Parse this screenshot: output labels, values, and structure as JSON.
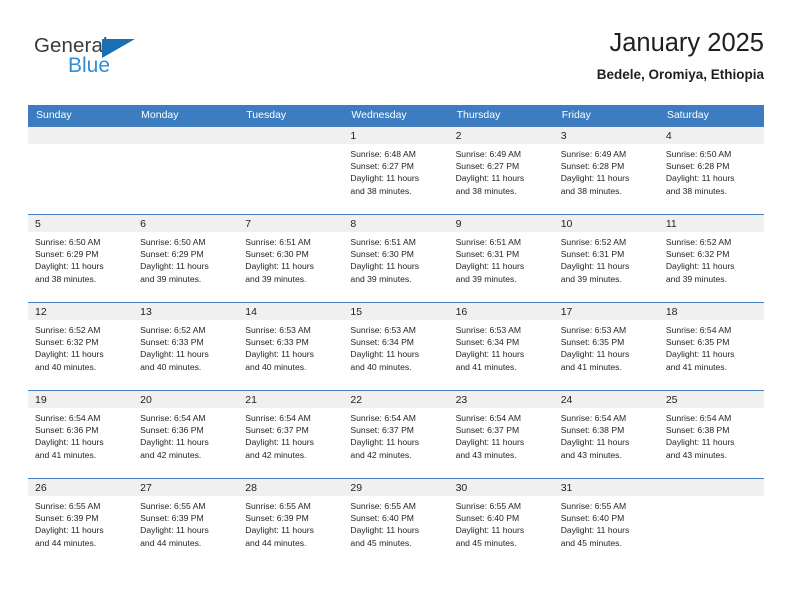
{
  "brand": {
    "name_primary": "General",
    "name_secondary": "Blue"
  },
  "header": {
    "title": "January 2025",
    "subtitle": "Bedele, Oromiya, Ethiopia"
  },
  "theme": {
    "header_blue": "#3c7cc0",
    "grid_line": "#4a7ebb",
    "daynum_band": "#f0f0f0",
    "logo_blue": "#2f8fd6",
    "logo_triangle": "#1a6fb5",
    "text": "#231f20"
  },
  "calendar": {
    "weekday_headers": [
      "Sunday",
      "Monday",
      "Tuesday",
      "Wednesday",
      "Thursday",
      "Friday",
      "Saturday"
    ],
    "weeks": [
      [
        {
          "day": "",
          "lines": []
        },
        {
          "day": "",
          "lines": []
        },
        {
          "day": "",
          "lines": []
        },
        {
          "day": "1",
          "lines": [
            "Sunrise: 6:48 AM",
            "Sunset: 6:27 PM",
            "Daylight: 11 hours",
            "and 38 minutes."
          ]
        },
        {
          "day": "2",
          "lines": [
            "Sunrise: 6:49 AM",
            "Sunset: 6:27 PM",
            "Daylight: 11 hours",
            "and 38 minutes."
          ]
        },
        {
          "day": "3",
          "lines": [
            "Sunrise: 6:49 AM",
            "Sunset: 6:28 PM",
            "Daylight: 11 hours",
            "and 38 minutes."
          ]
        },
        {
          "day": "4",
          "lines": [
            "Sunrise: 6:50 AM",
            "Sunset: 6:28 PM",
            "Daylight: 11 hours",
            "and 38 minutes."
          ]
        }
      ],
      [
        {
          "day": "5",
          "lines": [
            "Sunrise: 6:50 AM",
            "Sunset: 6:29 PM",
            "Daylight: 11 hours",
            "and 38 minutes."
          ]
        },
        {
          "day": "6",
          "lines": [
            "Sunrise: 6:50 AM",
            "Sunset: 6:29 PM",
            "Daylight: 11 hours",
            "and 39 minutes."
          ]
        },
        {
          "day": "7",
          "lines": [
            "Sunrise: 6:51 AM",
            "Sunset: 6:30 PM",
            "Daylight: 11 hours",
            "and 39 minutes."
          ]
        },
        {
          "day": "8",
          "lines": [
            "Sunrise: 6:51 AM",
            "Sunset: 6:30 PM",
            "Daylight: 11 hours",
            "and 39 minutes."
          ]
        },
        {
          "day": "9",
          "lines": [
            "Sunrise: 6:51 AM",
            "Sunset: 6:31 PM",
            "Daylight: 11 hours",
            "and 39 minutes."
          ]
        },
        {
          "day": "10",
          "lines": [
            "Sunrise: 6:52 AM",
            "Sunset: 6:31 PM",
            "Daylight: 11 hours",
            "and 39 minutes."
          ]
        },
        {
          "day": "11",
          "lines": [
            "Sunrise: 6:52 AM",
            "Sunset: 6:32 PM",
            "Daylight: 11 hours",
            "and 39 minutes."
          ]
        }
      ],
      [
        {
          "day": "12",
          "lines": [
            "Sunrise: 6:52 AM",
            "Sunset: 6:32 PM",
            "Daylight: 11 hours",
            "and 40 minutes."
          ]
        },
        {
          "day": "13",
          "lines": [
            "Sunrise: 6:52 AM",
            "Sunset: 6:33 PM",
            "Daylight: 11 hours",
            "and 40 minutes."
          ]
        },
        {
          "day": "14",
          "lines": [
            "Sunrise: 6:53 AM",
            "Sunset: 6:33 PM",
            "Daylight: 11 hours",
            "and 40 minutes."
          ]
        },
        {
          "day": "15",
          "lines": [
            "Sunrise: 6:53 AM",
            "Sunset: 6:34 PM",
            "Daylight: 11 hours",
            "and 40 minutes."
          ]
        },
        {
          "day": "16",
          "lines": [
            "Sunrise: 6:53 AM",
            "Sunset: 6:34 PM",
            "Daylight: 11 hours",
            "and 41 minutes."
          ]
        },
        {
          "day": "17",
          "lines": [
            "Sunrise: 6:53 AM",
            "Sunset: 6:35 PM",
            "Daylight: 11 hours",
            "and 41 minutes."
          ]
        },
        {
          "day": "18",
          "lines": [
            "Sunrise: 6:54 AM",
            "Sunset: 6:35 PM",
            "Daylight: 11 hours",
            "and 41 minutes."
          ]
        }
      ],
      [
        {
          "day": "19",
          "lines": [
            "Sunrise: 6:54 AM",
            "Sunset: 6:36 PM",
            "Daylight: 11 hours",
            "and 41 minutes."
          ]
        },
        {
          "day": "20",
          "lines": [
            "Sunrise: 6:54 AM",
            "Sunset: 6:36 PM",
            "Daylight: 11 hours",
            "and 42 minutes."
          ]
        },
        {
          "day": "21",
          "lines": [
            "Sunrise: 6:54 AM",
            "Sunset: 6:37 PM",
            "Daylight: 11 hours",
            "and 42 minutes."
          ]
        },
        {
          "day": "22",
          "lines": [
            "Sunrise: 6:54 AM",
            "Sunset: 6:37 PM",
            "Daylight: 11 hours",
            "and 42 minutes."
          ]
        },
        {
          "day": "23",
          "lines": [
            "Sunrise: 6:54 AM",
            "Sunset: 6:37 PM",
            "Daylight: 11 hours",
            "and 43 minutes."
          ]
        },
        {
          "day": "24",
          "lines": [
            "Sunrise: 6:54 AM",
            "Sunset: 6:38 PM",
            "Daylight: 11 hours",
            "and 43 minutes."
          ]
        },
        {
          "day": "25",
          "lines": [
            "Sunrise: 6:54 AM",
            "Sunset: 6:38 PM",
            "Daylight: 11 hours",
            "and 43 minutes."
          ]
        }
      ],
      [
        {
          "day": "26",
          "lines": [
            "Sunrise: 6:55 AM",
            "Sunset: 6:39 PM",
            "Daylight: 11 hours",
            "and 44 minutes."
          ]
        },
        {
          "day": "27",
          "lines": [
            "Sunrise: 6:55 AM",
            "Sunset: 6:39 PM",
            "Daylight: 11 hours",
            "and 44 minutes."
          ]
        },
        {
          "day": "28",
          "lines": [
            "Sunrise: 6:55 AM",
            "Sunset: 6:39 PM",
            "Daylight: 11 hours",
            "and 44 minutes."
          ]
        },
        {
          "day": "29",
          "lines": [
            "Sunrise: 6:55 AM",
            "Sunset: 6:40 PM",
            "Daylight: 11 hours",
            "and 45 minutes."
          ]
        },
        {
          "day": "30",
          "lines": [
            "Sunrise: 6:55 AM",
            "Sunset: 6:40 PM",
            "Daylight: 11 hours",
            "and 45 minutes."
          ]
        },
        {
          "day": "31",
          "lines": [
            "Sunrise: 6:55 AM",
            "Sunset: 6:40 PM",
            "Daylight: 11 hours",
            "and 45 minutes."
          ]
        },
        {
          "day": "",
          "lines": []
        }
      ]
    ]
  }
}
